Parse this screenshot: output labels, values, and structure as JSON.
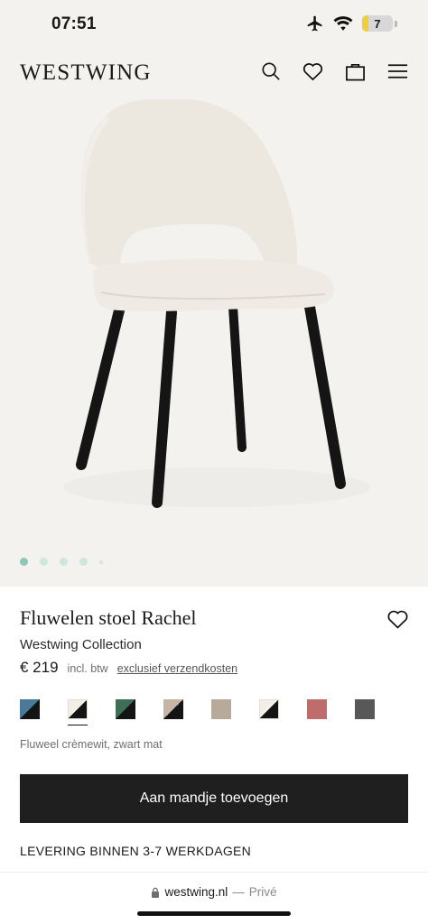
{
  "status_bar": {
    "time": "07:51",
    "battery": "7",
    "battery_level": 0.2
  },
  "header": {
    "brand": "WESTWING",
    "icons": [
      "search-icon",
      "heart-icon",
      "bag-icon",
      "menu-icon"
    ]
  },
  "gallery": {
    "slide_count": 5,
    "active_slide": 1
  },
  "product": {
    "title": "Fluwelen stoel Rachel",
    "brand": "Westwing Collection",
    "price": "€ 219",
    "vat_note": "incl. btw",
    "shipping_link": "exclusief verzendkosten"
  },
  "variants": {
    "selected_index": 1,
    "label": "Fluweel crèmewit, zwart mat",
    "swatches": [
      {
        "colors": [
          "#4a7a98",
          "#141414"
        ]
      },
      {
        "colors": [
          "#f3efe6",
          "#141414"
        ]
      },
      {
        "colors": [
          "#3f6e56",
          "#141414"
        ]
      },
      {
        "colors": [
          "#c8b4a4",
          "#141414"
        ]
      },
      {
        "colors": [
          "#b8aa9a",
          "#b8aa9a"
        ]
      },
      {
        "colors": [
          "#f3efe6",
          "#141414"
        ]
      },
      {
        "colors": [
          "#bf6c6c",
          "#bf6c6c"
        ]
      },
      {
        "colors": [
          "#585858",
          "#585858"
        ]
      }
    ]
  },
  "cart_button": "Aan mandje toevoegen",
  "delivery": "LEVERING BINNEN 3-7 WERKDAGEN",
  "browser": {
    "url": "westwing.nl",
    "separator": "—",
    "mode": "Privé"
  },
  "colors": {
    "page_bg": "#f3f2ef",
    "button_bg": "#1f1f1f",
    "dot_active": "#8cc7b9",
    "dot_inactive": "#cfe6e0"
  }
}
